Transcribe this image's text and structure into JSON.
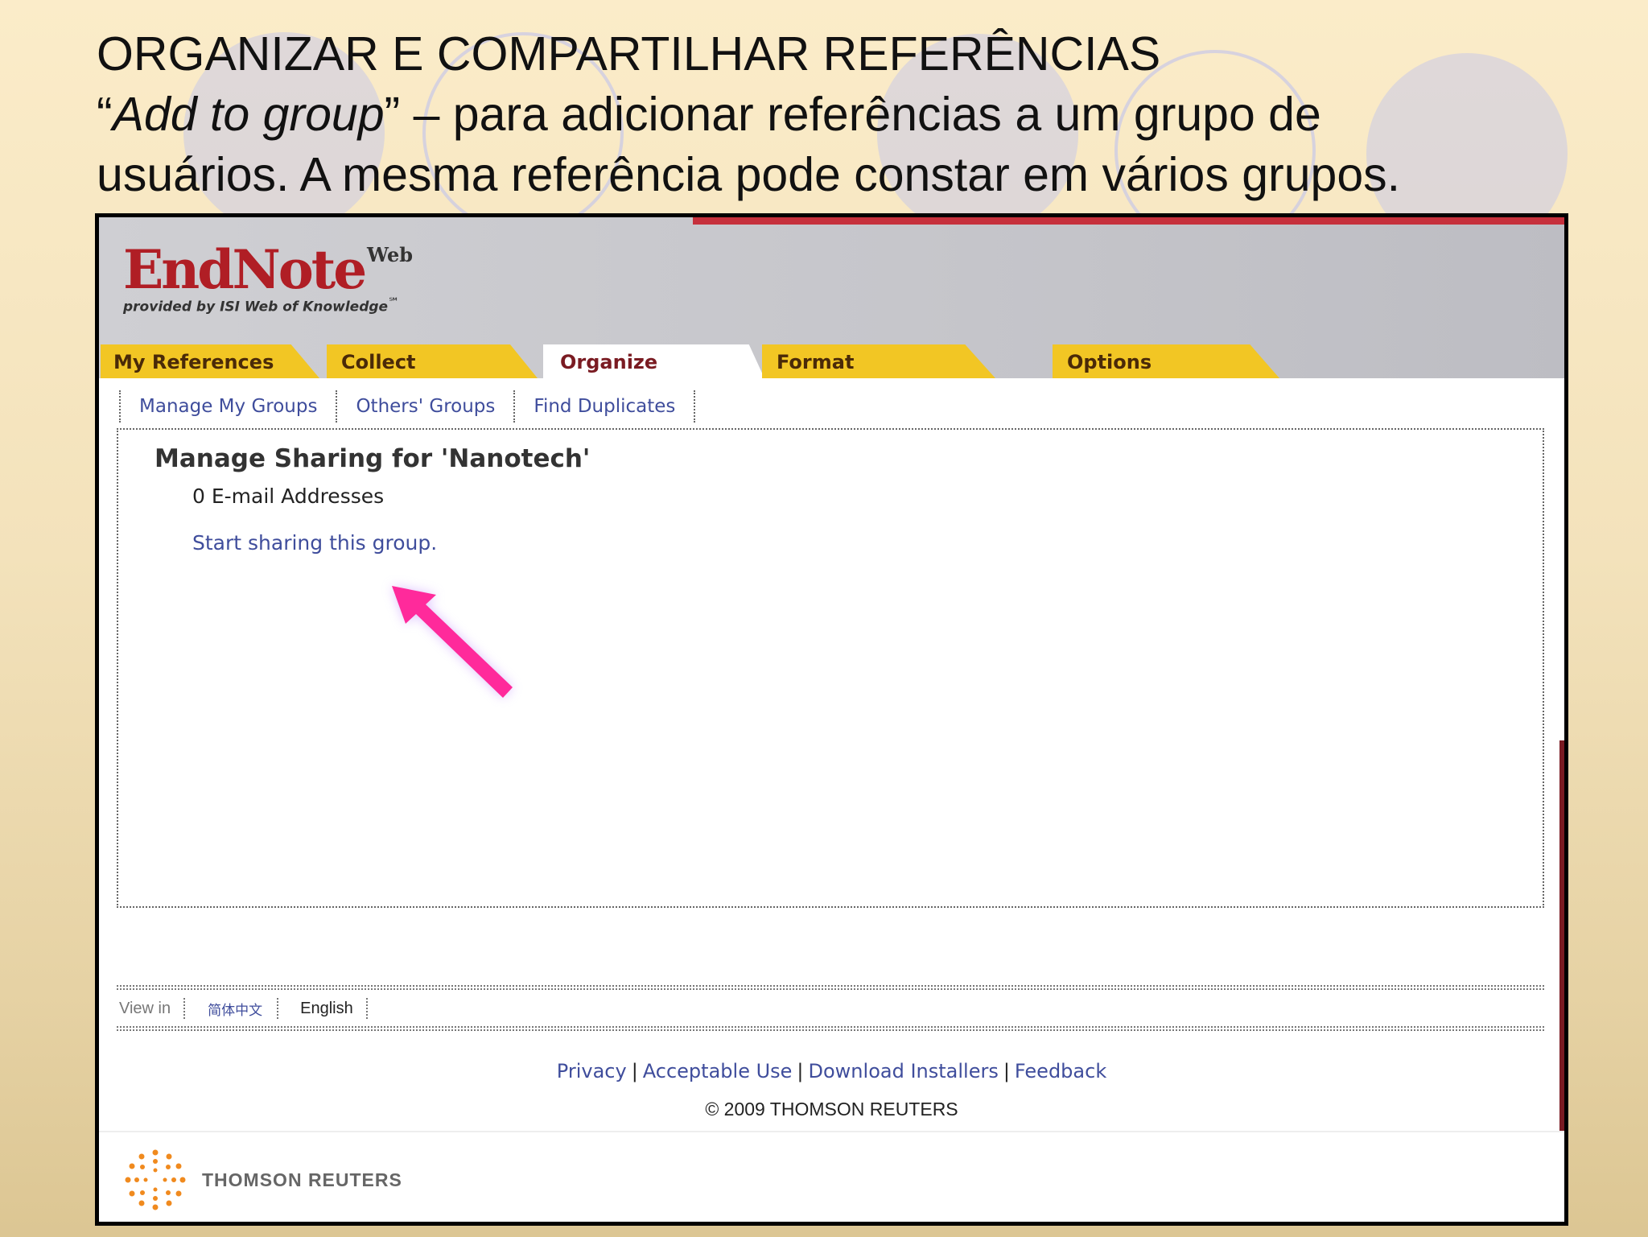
{
  "slide": {
    "title_line1": "ORGANIZAR E COMPARTILHAR REFERÊNCIAS",
    "title_line2_quote_open": "“",
    "title_line2_italic": "Add to group",
    "title_line2_rest": "” – para adicionar referências a um grupo de",
    "title_line3": "usuários. A mesma referência pode constar em vários grupos."
  },
  "app": {
    "logo_main": "EndNote",
    "logo_sup": "Web",
    "logo_sub": "provided by ISI Web of Knowledge",
    "logo_trademark": "℠"
  },
  "tabs": [
    {
      "label": "My References"
    },
    {
      "label": "Collect"
    },
    {
      "label": "Organize"
    },
    {
      "label": "Format"
    },
    {
      "label": "Options"
    }
  ],
  "active_tab": "Organize",
  "subnav": [
    {
      "label": "Manage My Groups"
    },
    {
      "label": "Others' Groups"
    },
    {
      "label": "Find Duplicates"
    }
  ],
  "content": {
    "title": "Manage Sharing for 'Nanotech'",
    "email_count": "0 E-mail Addresses",
    "share_link": "Start sharing this group."
  },
  "footer": {
    "view_in_label": "View in",
    "lang_chinese": "简体中文",
    "lang_english": "English",
    "links": [
      "Privacy",
      "Acceptable Use",
      "Download Installers",
      "Feedback"
    ],
    "copyright": "© 2009 THOMSON REUTERS",
    "company": "THOMSON REUTERS"
  },
  "colors": {
    "tab_yellow": "#f2c624",
    "endnote_red": "#b01e25",
    "link_blue": "#3f4d9c",
    "arrow_pink": "#ff2a9b"
  }
}
